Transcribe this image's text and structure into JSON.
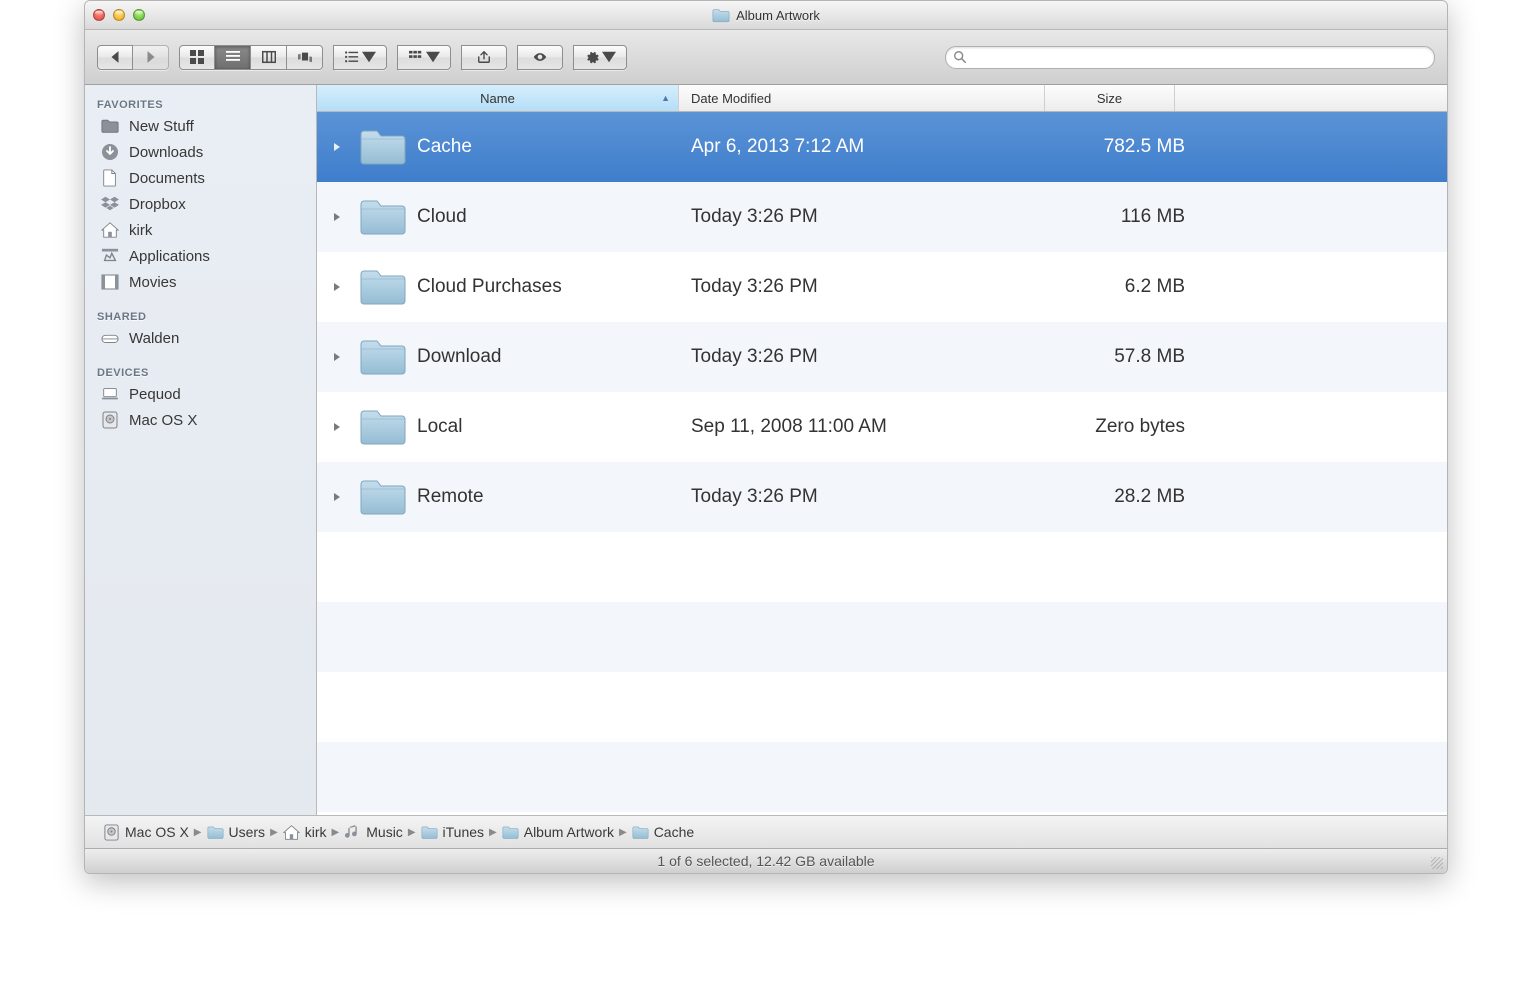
{
  "window": {
    "title": "Album Artwork"
  },
  "sidebar": {
    "sections": [
      {
        "heading": "FAVORITES",
        "items": [
          {
            "label": "New Stuff",
            "icon": "folder"
          },
          {
            "label": "Downloads",
            "icon": "download"
          },
          {
            "label": "Documents",
            "icon": "document"
          },
          {
            "label": "Dropbox",
            "icon": "dropbox"
          },
          {
            "label": "kirk",
            "icon": "home"
          },
          {
            "label": "Applications",
            "icon": "app"
          },
          {
            "label": "Movies",
            "icon": "movie"
          }
        ]
      },
      {
        "heading": "SHARED",
        "items": [
          {
            "label": "Walden",
            "icon": "server"
          }
        ]
      },
      {
        "heading": "DEVICES",
        "items": [
          {
            "label": "Pequod",
            "icon": "laptop"
          },
          {
            "label": "Mac OS X",
            "icon": "hdd"
          }
        ]
      }
    ]
  },
  "columns": {
    "name": "Name",
    "date": "Date Modified",
    "size": "Size"
  },
  "rows": [
    {
      "name": "Cache",
      "date": "Apr 6, 2013 7:12 AM",
      "size": "782.5 MB",
      "selected": true
    },
    {
      "name": "Cloud",
      "date": "Today 3:26 PM",
      "size": "116 MB",
      "selected": false
    },
    {
      "name": "Cloud Purchases",
      "date": "Today 3:26 PM",
      "size": "6.2 MB",
      "selected": false
    },
    {
      "name": "Download",
      "date": "Today 3:26 PM",
      "size": "57.8 MB",
      "selected": false
    },
    {
      "name": "Local",
      "date": "Sep 11, 2008 11:00 AM",
      "size": "Zero bytes",
      "selected": false
    },
    {
      "name": "Remote",
      "date": "Today 3:26 PM",
      "size": "28.2 MB",
      "selected": false
    }
  ],
  "path": [
    {
      "label": "Mac OS X",
      "icon": "hdd"
    },
    {
      "label": "Users",
      "icon": "folder"
    },
    {
      "label": "kirk",
      "icon": "home"
    },
    {
      "label": "Music",
      "icon": "music"
    },
    {
      "label": "iTunes",
      "icon": "folder"
    },
    {
      "label": "Album Artwork",
      "icon": "folder"
    },
    {
      "label": "Cache",
      "icon": "folder"
    }
  ],
  "status": "1 of 6 selected, 12.42 GB available",
  "search": {
    "placeholder": ""
  }
}
